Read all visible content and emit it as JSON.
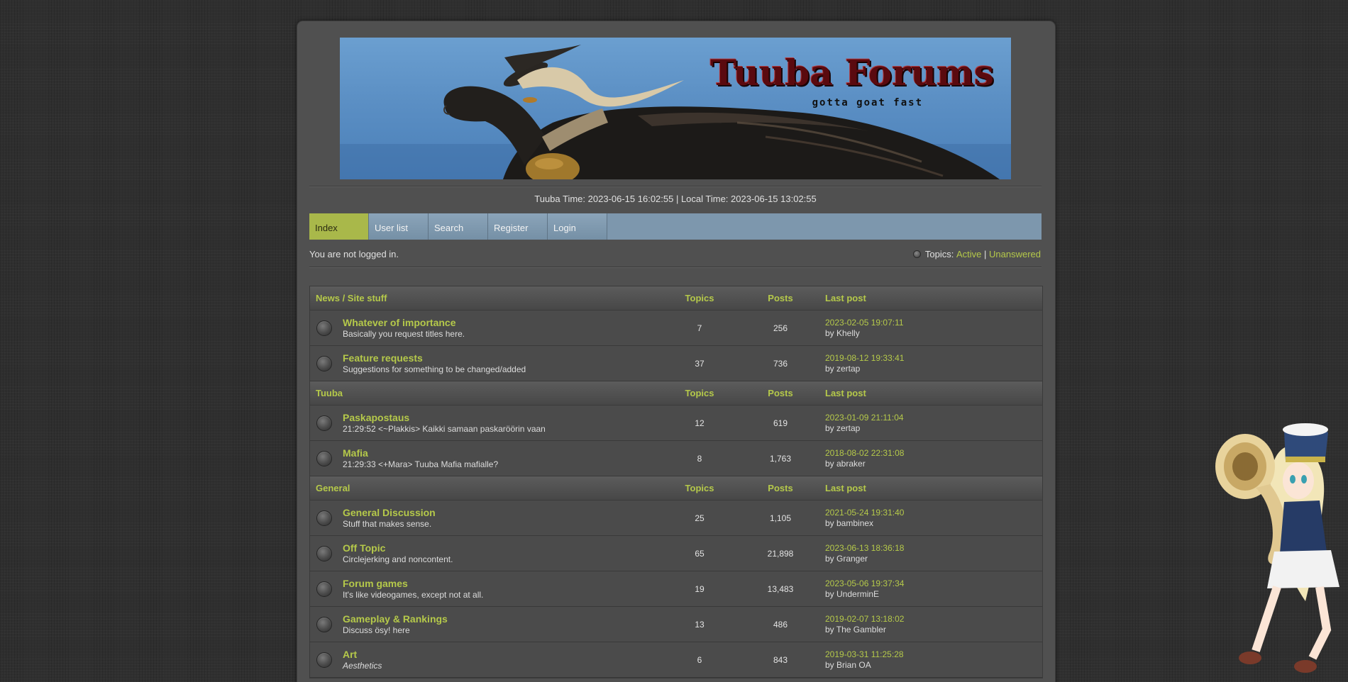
{
  "banner": {
    "title": "Tuuba Forums",
    "slogan": "gotta goat fast"
  },
  "time_line": "Tuuba Time: 2023-06-15 16:02:55 | Local Time: 2023-06-15 13:02:55",
  "nav": {
    "items": [
      {
        "label": "Index"
      },
      {
        "label": "User list"
      },
      {
        "label": "Search"
      },
      {
        "label": "Register"
      },
      {
        "label": "Login"
      }
    ]
  },
  "status": {
    "logged_out": "You are not logged in.",
    "topics_label": "Topics:",
    "active": "Active",
    "separator": "|",
    "unanswered": "Unanswered"
  },
  "columns": {
    "topics": "Topics",
    "posts": "Posts",
    "last_post": "Last post"
  },
  "categories": [
    {
      "name": "News / Site stuff",
      "forums": [
        {
          "name": "Whatever of importance",
          "desc": "Basically you request titles here.",
          "topics": "7",
          "posts": "256",
          "last_date": "2023-02-05 19:07:11",
          "last_by": "by Khelly"
        },
        {
          "name": "Feature requests",
          "desc": "Suggestions for something to be changed/added",
          "topics": "37",
          "posts": "736",
          "last_date": "2019-08-12 19:33:41",
          "last_by": "by zertap"
        }
      ]
    },
    {
      "name": "Tuuba",
      "forums": [
        {
          "name": "Paskapostaus",
          "desc": "21:29:52 <~Plakkis> Kaikki samaan paskaröörin vaan",
          "topics": "12",
          "posts": "619",
          "last_date": "2023-01-09 21:11:04",
          "last_by": "by zertap"
        },
        {
          "name": "Mafia",
          "desc": "21:29:33 <+Mara> Tuuba Mafia mafialle?",
          "topics": "8",
          "posts": "1,763",
          "last_date": "2018-08-02 22:31:08",
          "last_by": "by abraker"
        }
      ]
    },
    {
      "name": "General",
      "forums": [
        {
          "name": "General Discussion",
          "desc": "Stuff that makes sense.",
          "topics": "25",
          "posts": "1,105",
          "last_date": "2021-05-24 19:31:40",
          "last_by": "by bambinex"
        },
        {
          "name": "Off Topic",
          "desc": "Circlejerking and noncontent.",
          "topics": "65",
          "posts": "21,898",
          "last_date": "2023-06-13 18:36:18",
          "last_by": "by Granger"
        },
        {
          "name": "Forum games",
          "desc": "It's like videogames, except not at all.",
          "topics": "19",
          "posts": "13,483",
          "last_date": "2023-05-06 19:37:34",
          "last_by": "by UnderminE"
        },
        {
          "name": "Gameplay & Rankings",
          "desc": "Discuss ösy! here",
          "topics": "13",
          "posts": "486",
          "last_date": "2019-02-07 13:18:02",
          "last_by": "by The Gambler"
        },
        {
          "name": "Art",
          "desc": "Aesthetics",
          "topics": "6",
          "posts": "843",
          "last_date": "2019-03-31 11:25:28",
          "last_by": "by Brian OA"
        }
      ]
    }
  ],
  "colors": {
    "accent": "#b5c94a",
    "nav_bar": "#7d97ad",
    "nav_active": "#a9b84a",
    "panel": "#505050",
    "background": "#2f2f2f"
  }
}
